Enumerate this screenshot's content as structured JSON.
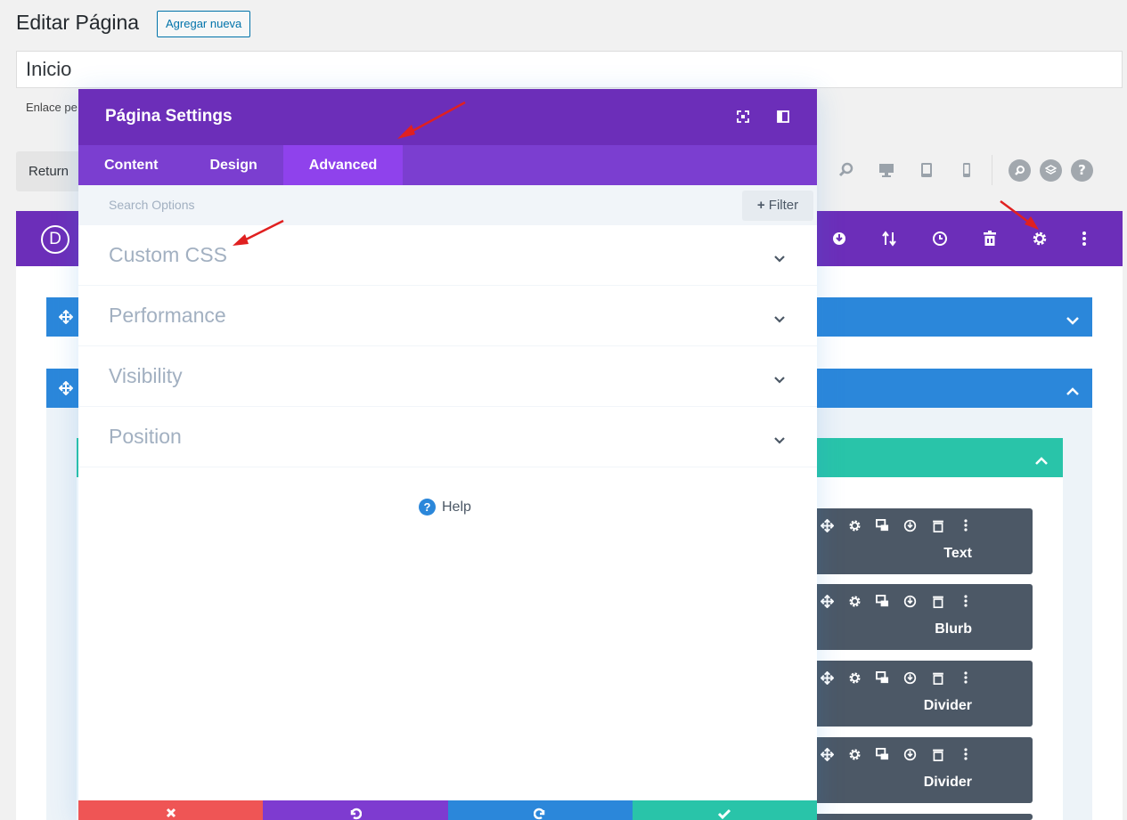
{
  "wp": {
    "page_title": "Editar Página",
    "add_new_label": "Agregar nueva",
    "post_title": "Inicio",
    "permalink_label": "Enlace pe",
    "return_label": "Return"
  },
  "toolbar": {
    "icons": [
      "zoom-icon",
      "desktop-icon",
      "tablet-icon",
      "phone-icon",
      "search-circle-icon",
      "layers-icon",
      "help-icon"
    ]
  },
  "builder": {
    "logo_letter": "D",
    "bar_icons": [
      "power-icon",
      "portability-icon",
      "history-icon",
      "trash-icon",
      "gear-icon",
      "more-icon"
    ],
    "modules": [
      {
        "label": "Text"
      },
      {
        "label": "Blurb"
      },
      {
        "label": "Divider"
      },
      {
        "label": "Divider"
      }
    ]
  },
  "modal": {
    "title": "Página Settings",
    "tabs": [
      {
        "label": "Content",
        "active": false
      },
      {
        "label": "Design",
        "active": false
      },
      {
        "label": "Advanced",
        "active": true
      }
    ],
    "search_placeholder": "Search Options",
    "filter_label": "Filter",
    "toggles": [
      {
        "label": "Custom CSS"
      },
      {
        "label": "Performance"
      },
      {
        "label": "Visibility"
      },
      {
        "label": "Position"
      }
    ],
    "help_label": "Help",
    "footer_colors": [
      "#ef5555",
      "#7e3bd0",
      "#2b87da",
      "#29c4a9"
    ]
  },
  "colors": {
    "purple": "#6c2eb9",
    "tab_bar": "#7b3ed0",
    "tab_active": "#8f42ec",
    "section_blue": "#2b87da",
    "row_green": "#29c4a9",
    "module_dark": "#4c5866",
    "annotation_red": "#e02020"
  }
}
